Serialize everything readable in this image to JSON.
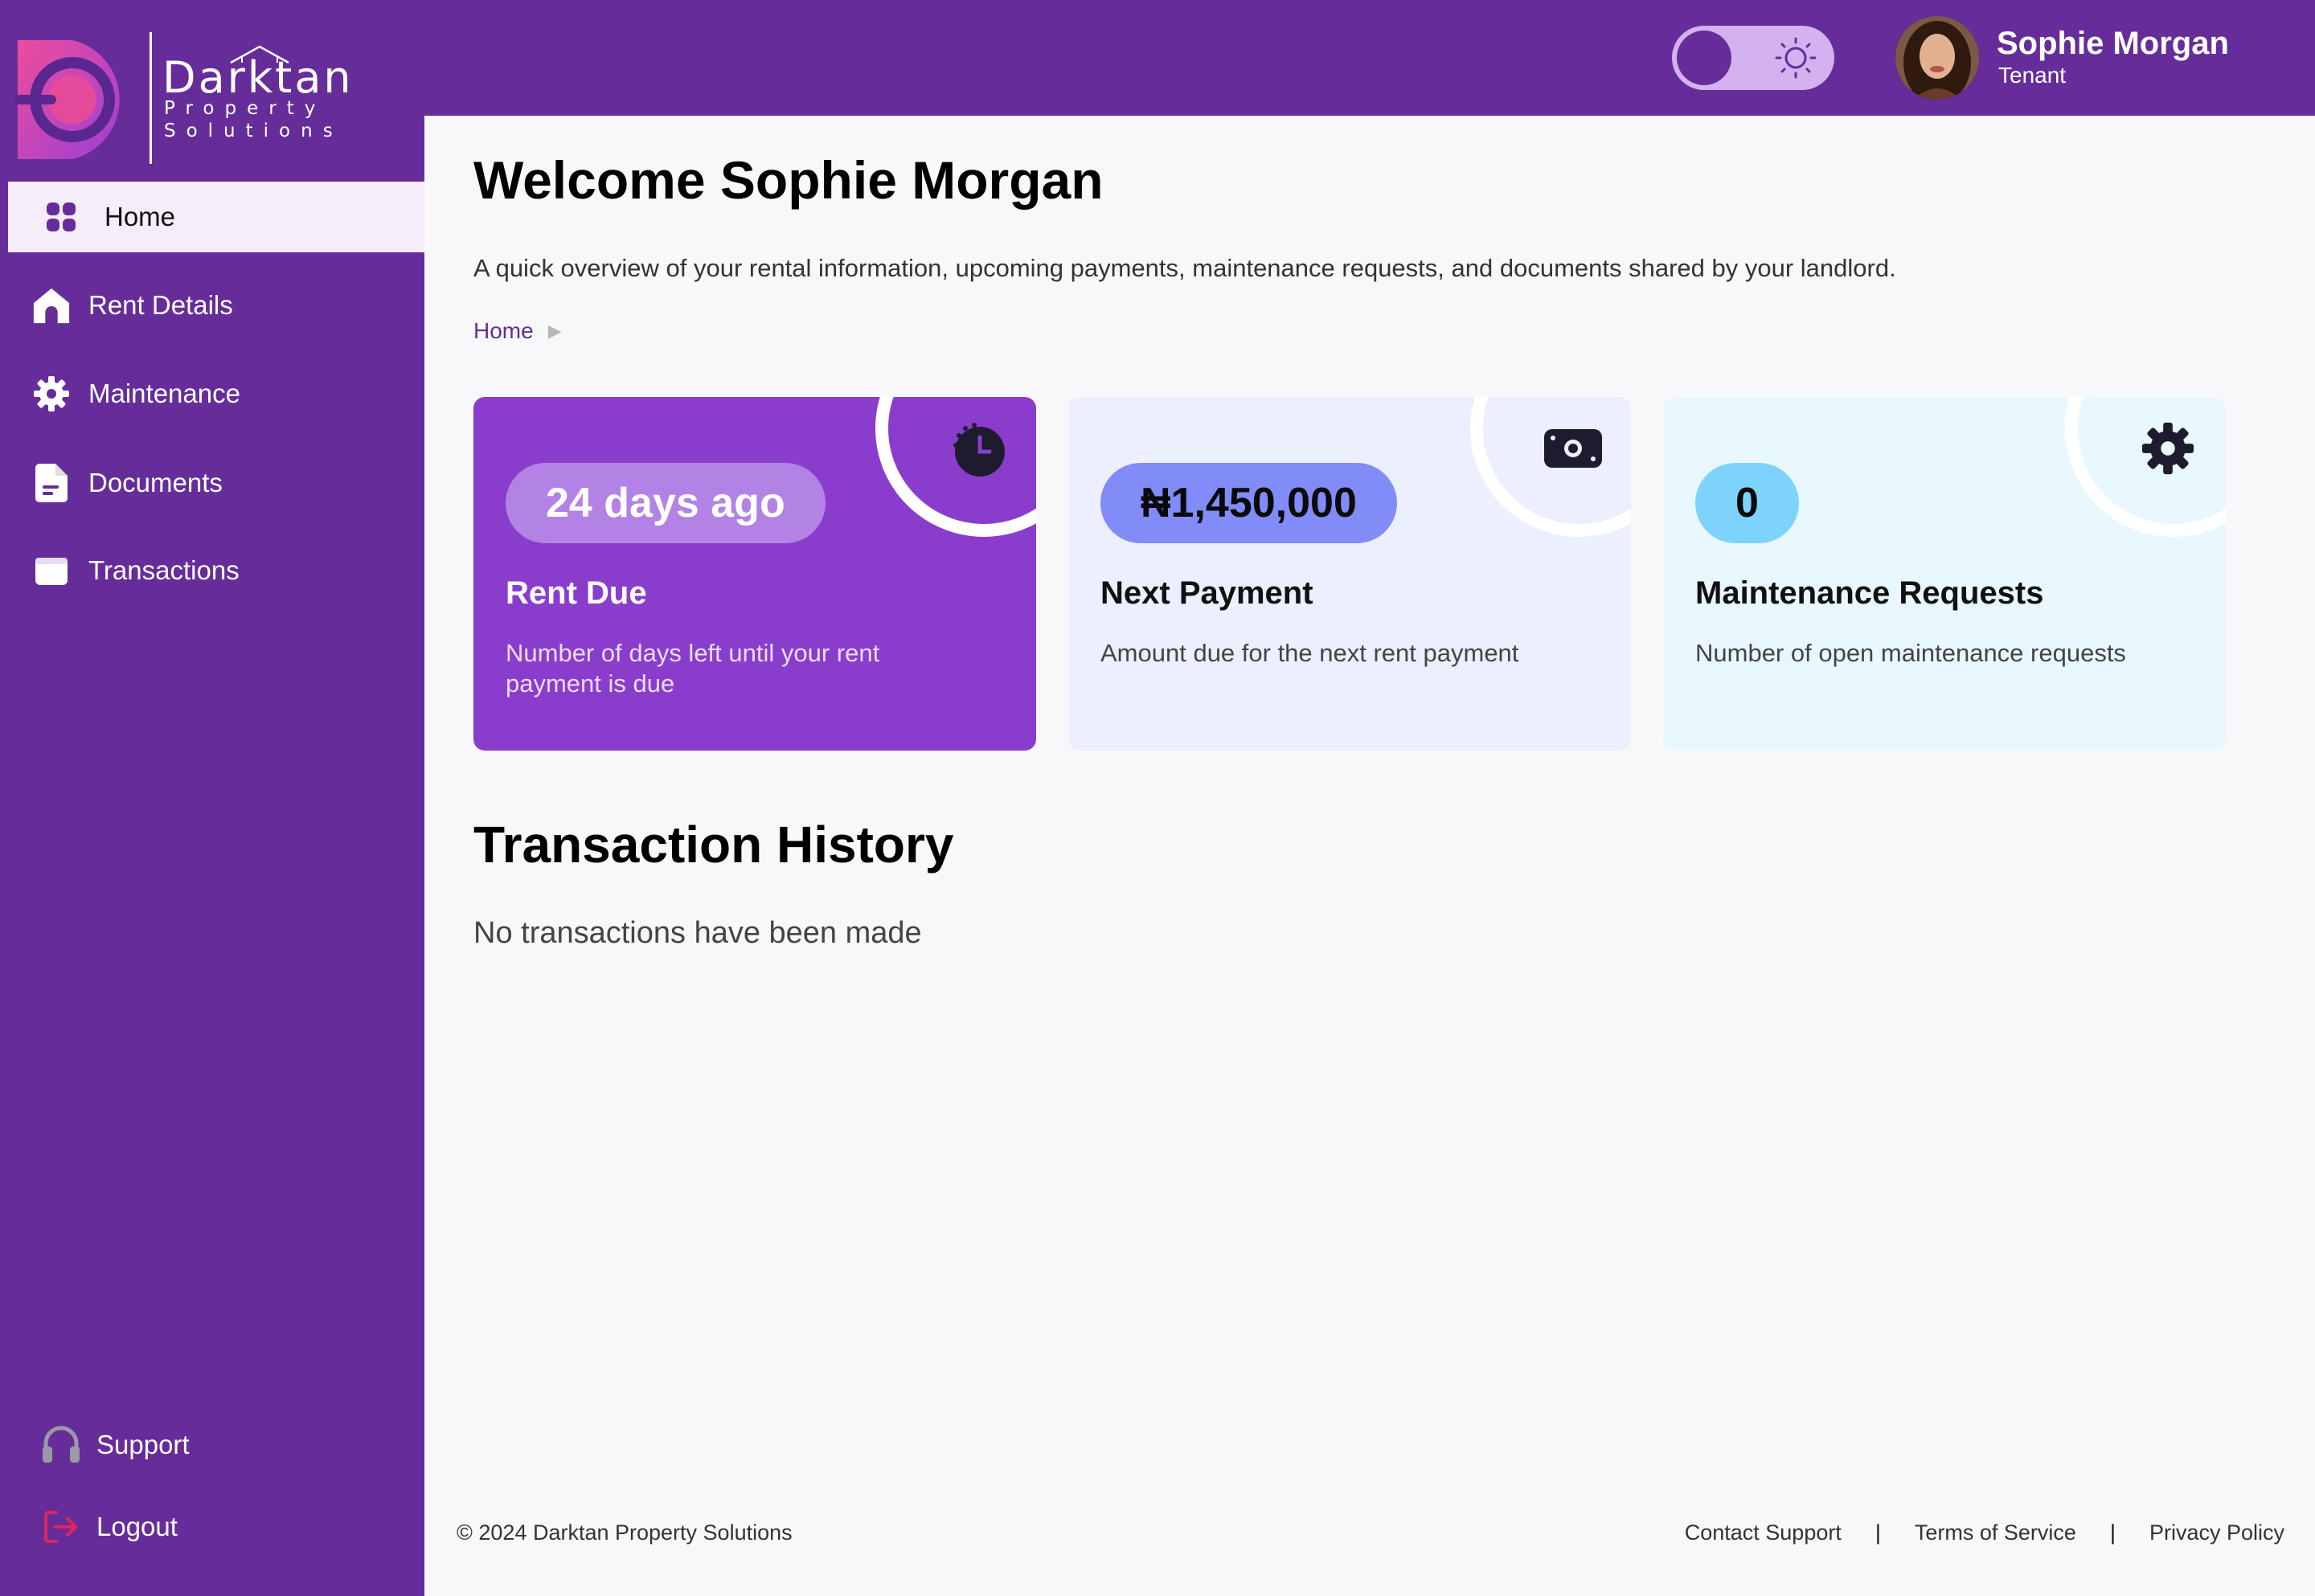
{
  "brand": {
    "name": "Darktan",
    "tagline_line1": "Property",
    "tagline_line2": "Solutions"
  },
  "sidebar": {
    "items": [
      {
        "label": "Home",
        "icon": "grid-icon",
        "active": true
      },
      {
        "label": "Rent Details",
        "icon": "house-icon"
      },
      {
        "label": "Maintenance",
        "icon": "gear-icon"
      },
      {
        "label": "Documents",
        "icon": "document-icon"
      },
      {
        "label": "Transactions",
        "icon": "wallet-icon"
      }
    ],
    "bottom": [
      {
        "label": "Support",
        "icon": "headset-icon"
      },
      {
        "label": "Logout",
        "icon": "logout-icon"
      }
    ]
  },
  "header": {
    "theme_toggle": {
      "icon": "sun-icon",
      "mode": "light"
    },
    "user": {
      "name": "Sophie Morgan",
      "role": "Tenant"
    }
  },
  "main": {
    "title": "Welcome Sophie Morgan",
    "description": "A quick overview of your rental information, upcoming payments, maintenance requests, and documents shared by your landlord.",
    "breadcrumb": [
      "Home"
    ],
    "cards": [
      {
        "value": "24 days ago",
        "title": "Rent Due",
        "description": "Number of days left until your rent payment is due",
        "icon": "clock-icon"
      },
      {
        "value": "₦1,450,000",
        "title": "Next Payment",
        "description": "Amount due for the next rent payment",
        "icon": "cash-icon"
      },
      {
        "value": "0",
        "title": "Maintenance Requests",
        "description": "Number of open maintenance requests",
        "icon": "gear-icon"
      }
    ],
    "transactions": {
      "title": "Transaction History",
      "empty_message": "No transactions have been made"
    }
  },
  "footer": {
    "copyright": "© 2024 Darktan Property Solutions",
    "links": [
      "Contact Support",
      "Terms of Service",
      "Privacy Policy"
    ]
  },
  "colors": {
    "primary": "#662d9a",
    "rent_card": "#8a3dcc",
    "payment_card": "#eceffd",
    "maintenance_card": "#e8f8fe",
    "logout_icon": "#e0245e"
  }
}
